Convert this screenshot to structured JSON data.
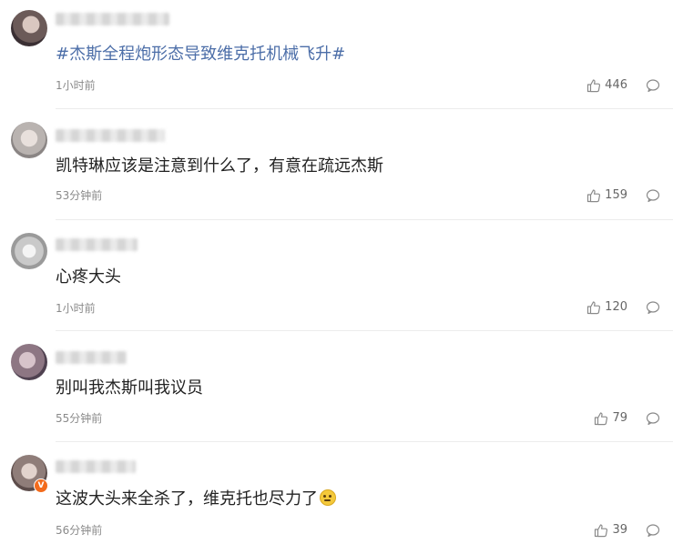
{
  "comments": [
    {
      "text": "#杰斯全程炮形态导致维克托机械飞升#",
      "time": "1小时前",
      "likes": "446"
    },
    {
      "text": "凯特琳应该是注意到什么了，有意在疏远杰斯",
      "time": "53分钟前",
      "likes": "159"
    },
    {
      "text": "心疼大头",
      "time": "1小时前",
      "likes": "120"
    },
    {
      "text": "别叫我杰斯叫我议员",
      "time": "55分钟前",
      "likes": "79"
    },
    {
      "text": "这波大头来全杀了，维克托也尽力了",
      "time": "56分钟前",
      "likes": "39",
      "badge": "V",
      "emoji": "doge-emoji"
    }
  ],
  "icons": {
    "like": "thumbs-up-icon",
    "reply": "comment-bubble-icon"
  },
  "colors": {
    "topic": "#4c6ea8",
    "meta": "#8a8a8a",
    "divider": "#ececec",
    "badge": "#f36b1c"
  }
}
